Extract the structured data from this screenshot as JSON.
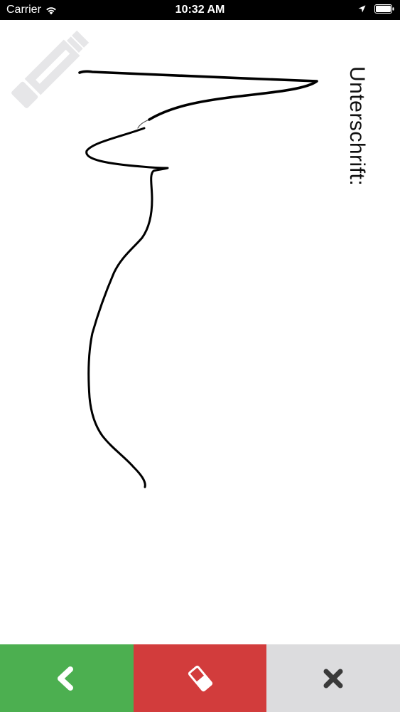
{
  "status_bar": {
    "carrier": "Carrier",
    "time": "10:32 AM",
    "icons": [
      "wifi-icon",
      "location-icon",
      "battery-icon"
    ]
  },
  "signature": {
    "label": "Unterschrift:",
    "watermark_icon": "pencil-icon",
    "has_signature": true
  },
  "toolbar": {
    "buttons": [
      {
        "icon": "chevron-left-icon",
        "color": "#4caf50"
      },
      {
        "icon": "eraser-icon",
        "color": "#d23c3c"
      },
      {
        "icon": "close-icon",
        "color": "#dcdcde"
      }
    ]
  },
  "colors": {
    "status_bar": "#000000",
    "canvas": "#ffffff",
    "ink": "#000000",
    "watermark": "#e6e6e8"
  }
}
